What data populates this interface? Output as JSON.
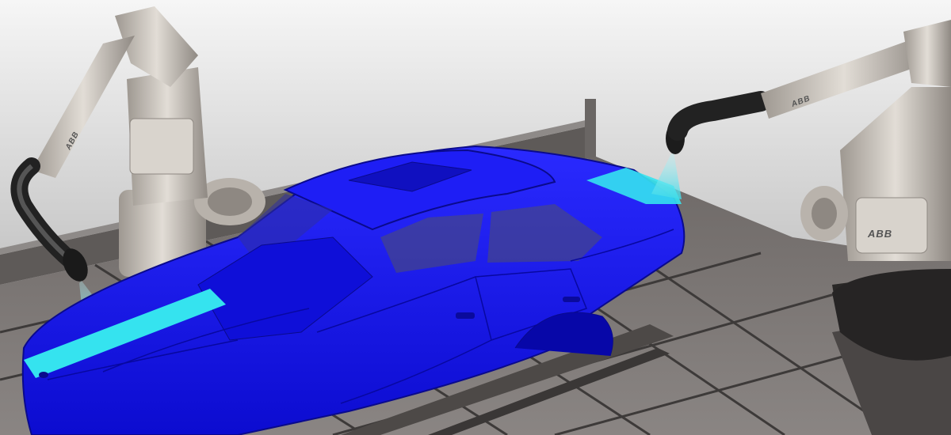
{
  "scene": {
    "description_kind": "rendered-3d-illustration",
    "colors": {
      "background_top": "#f4f4f4",
      "background_bottom": "#a9a9a9",
      "car_body": "#1414f0",
      "car_lines": "#0a0a8c",
      "paint_stripe": "#35e3ef",
      "spray_cone": "#7fe8f0",
      "robot_metal": "#c9c4bd",
      "robot_dark": "#2a2a2a",
      "floor_tile": "#7c7775",
      "floor_grout": "#3b3837"
    }
  },
  "robots": {
    "left_brand": "ABB",
    "right_brand": "ABB"
  }
}
